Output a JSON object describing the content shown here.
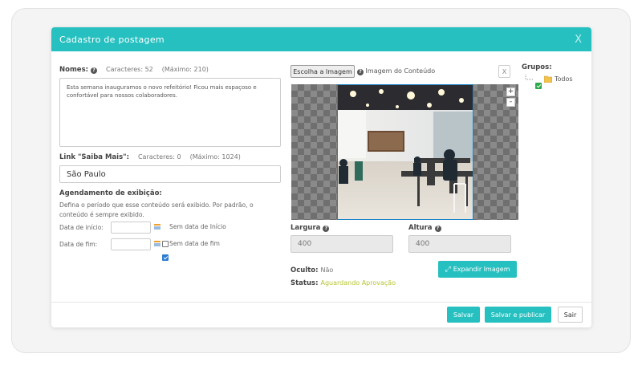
{
  "modal": {
    "title": "Cadastro de postagem",
    "close_label": "X"
  },
  "nomes": {
    "label": "Nomes:",
    "chars": "Caracteres: 52",
    "max": "(Máximo: 210)",
    "value": "Esta semana inauguramos o novo refeitório! Ficou mais espaçoso e confortável para nossos colaboradores."
  },
  "link": {
    "label": "Link \"Saiba Mais\":",
    "chars": "Caracteres: 0",
    "max": "(Máximo: 1024)",
    "value": "São Paulo"
  },
  "agendamento": {
    "title": "Agendamento de exibição:",
    "desc": "Defina o período que esse conteúdo será exibido. Por padrão, o conteúdo é sempre exibido.",
    "start_label": "Data de início:",
    "start_value": "",
    "no_start_label": "Sem data de Início",
    "no_start_checked": true,
    "end_label": "Data de fim:",
    "end_value": "",
    "no_end_label": "Sem data de fim",
    "no_end_checked": false
  },
  "image": {
    "choose_label": "Escolha a Imagem",
    "info_label": "Imagem do Conteúdo",
    "remove_label": "X",
    "zoom_in": "+",
    "zoom_out": "-",
    "largura_label": "Largura",
    "largura_value": "400",
    "altura_label": "Altura",
    "altura_value": "400",
    "expand_label": "Expandir Imagem"
  },
  "status": {
    "oculto_label": "Oculto:",
    "oculto_value": "Não",
    "status_label": "Status:",
    "status_value": "Aguardando Aprovação",
    "status_color": "#b7c531"
  },
  "grupos": {
    "label": "Grupos:",
    "items": [
      {
        "label": "Todos",
        "checked": true
      }
    ]
  },
  "footer": {
    "save": "Salvar",
    "save_publish": "Salvar e publicar",
    "exit": "Sair"
  },
  "colors": {
    "accent": "#27c0c0",
    "checkbox": "#2d7dd2"
  }
}
